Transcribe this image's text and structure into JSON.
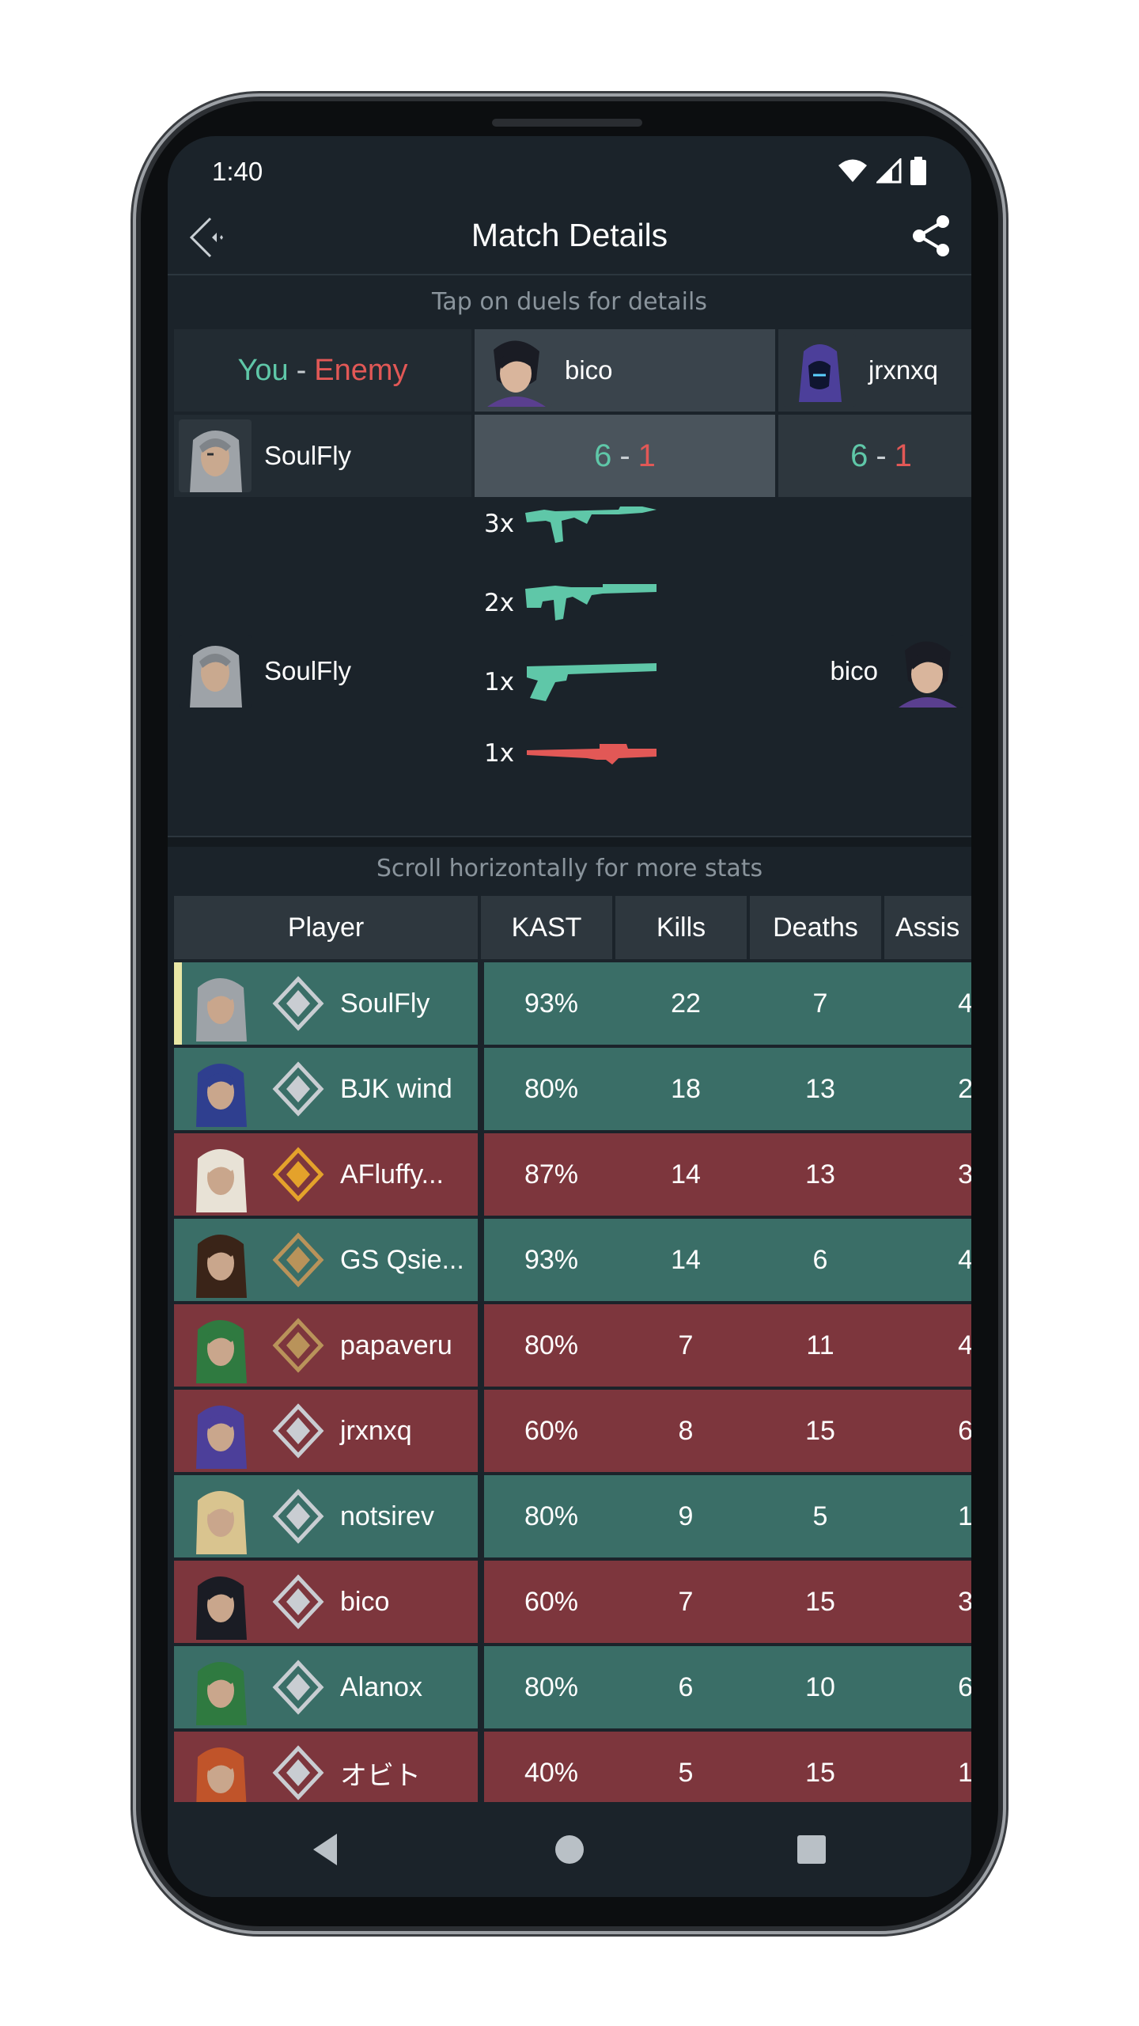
{
  "status": {
    "time": "1:40"
  },
  "appbar": {
    "title": "Match Details"
  },
  "duels": {
    "hint": "Tap on duels for details",
    "you_label": "You",
    "dash": "-",
    "enemy_label": "Enemy",
    "enemies": [
      {
        "name": "bico"
      },
      {
        "name": "jrxnxq"
      }
    ],
    "player": "SoulFly",
    "scores": [
      {
        "you": "6",
        "enemy": "1"
      },
      {
        "you": "6",
        "enemy": "1"
      }
    ]
  },
  "duel_detail": {
    "left_player": "SoulFly",
    "right_player": "bico",
    "weapons": [
      {
        "count": "3x",
        "weapon": "rifle-vandal",
        "color": "#5fc7a8"
      },
      {
        "count": "2x",
        "weapon": "smg-spectre",
        "color": "#5fc7a8"
      },
      {
        "count": "1x",
        "weapon": "pistol-sheriff",
        "color": "#5fc7a8"
      },
      {
        "count": "1x",
        "weapon": "sniper-operator",
        "color": "#e25856"
      }
    ]
  },
  "stats": {
    "hint": "Scroll horizontally for more stats",
    "headers": [
      "Player",
      "KAST",
      "Kills",
      "Deaths",
      "Assis"
    ],
    "rows": [
      {
        "name": "SoulFly",
        "kast": "93%",
        "kills": "22",
        "deaths": "7",
        "assists": "4",
        "result": "win"
      },
      {
        "name": "BJK wind",
        "kast": "80%",
        "kills": "18",
        "deaths": "13",
        "assists": "2",
        "result": "win"
      },
      {
        "name": "AFluffy...",
        "kast": "87%",
        "kills": "14",
        "deaths": "13",
        "assists": "3",
        "result": "loss"
      },
      {
        "name": "GS Qsie...",
        "kast": "93%",
        "kills": "14",
        "deaths": "6",
        "assists": "4",
        "result": "win"
      },
      {
        "name": "papaveru",
        "kast": "80%",
        "kills": "7",
        "deaths": "11",
        "assists": "4",
        "result": "loss"
      },
      {
        "name": "jrxnxq",
        "kast": "60%",
        "kills": "8",
        "deaths": "15",
        "assists": "6",
        "result": "loss"
      },
      {
        "name": "notsirev",
        "kast": "80%",
        "kills": "9",
        "deaths": "5",
        "assists": "1",
        "result": "win"
      },
      {
        "name": "bico",
        "kast": "60%",
        "kills": "7",
        "deaths": "15",
        "assists": "3",
        "result": "loss"
      },
      {
        "name": "Alanox",
        "kast": "80%",
        "kills": "6",
        "deaths": "10",
        "assists": "6",
        "result": "win"
      },
      {
        "name": "オビト",
        "kast": "40%",
        "kills": "5",
        "deaths": "15",
        "assists": "1",
        "result": "loss"
      }
    ]
  },
  "colors": {
    "win": "#3a6e67",
    "loss": "#7d363d",
    "you": "#5fc7a8",
    "enemy": "#e25856"
  }
}
